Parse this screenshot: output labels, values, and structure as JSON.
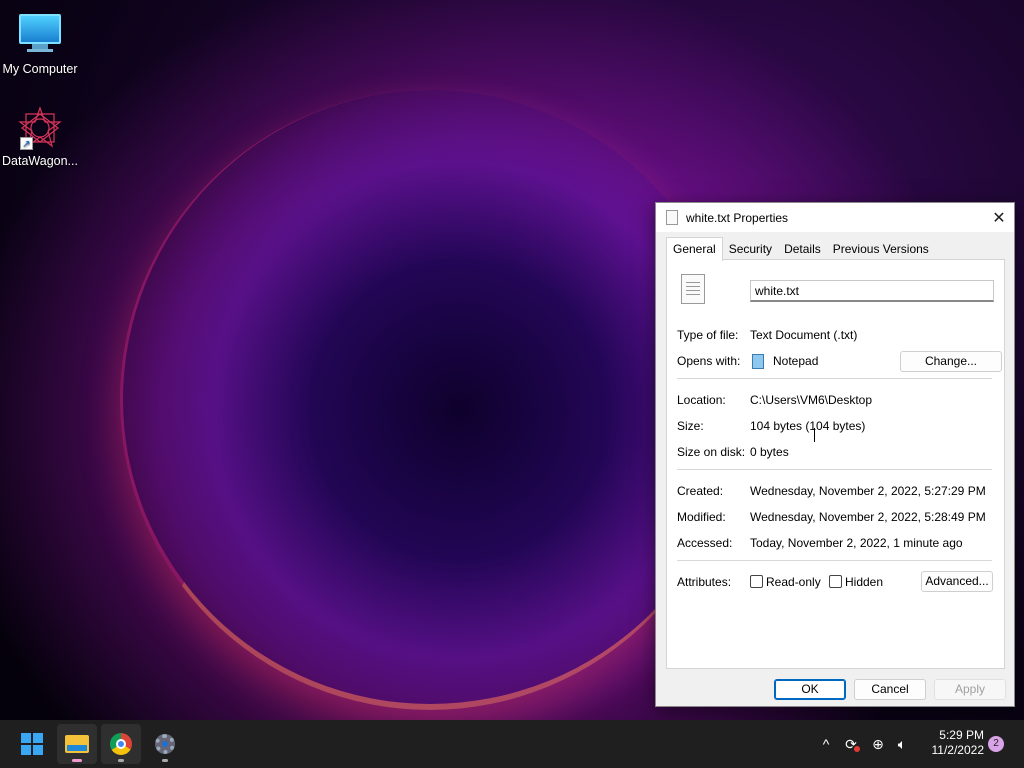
{
  "desktop": {
    "icons": [
      {
        "label": "My Computer",
        "icon": "monitor-icon"
      },
      {
        "label": "DataWagon...",
        "icon": "datawagon-icon"
      }
    ]
  },
  "dialog": {
    "title": "white.txt Properties",
    "tabs": [
      "General",
      "Security",
      "Details",
      "Previous Versions"
    ],
    "active_tab": "General",
    "filename": "white.txt",
    "type_label": "Type of file:",
    "type_value": "Text Document (.txt)",
    "opens_label": "Opens with:",
    "opens_value": "Notepad",
    "change_button": "Change...",
    "location_label": "Location:",
    "location_value": "C:\\Users\\VM6\\Desktop",
    "size_label": "Size:",
    "size_value": "104 bytes (104 bytes)",
    "size_on_disk_label": "Size on disk:",
    "size_on_disk_value": "0 bytes",
    "created_label": "Created:",
    "created_value": "Wednesday, November 2, 2022, 5:27:29 PM",
    "modified_label": "Modified:",
    "modified_value": "Wednesday, November 2, 2022, 5:28:49 PM",
    "accessed_label": "Accessed:",
    "accessed_value": "Today, November 2, 2022, 1 minute ago",
    "attributes_label": "Attributes:",
    "readonly_label": "Read-only",
    "hidden_label": "Hidden",
    "advanced_button": "Advanced...",
    "ok_button": "OK",
    "cancel_button": "Cancel",
    "apply_button": "Apply"
  },
  "taskbar": {
    "time": "5:29 PM",
    "date": "11/2/2022",
    "notifications": "2"
  },
  "colors": {
    "accent": "#0067c0",
    "taskbar": "#1f1f1f"
  }
}
